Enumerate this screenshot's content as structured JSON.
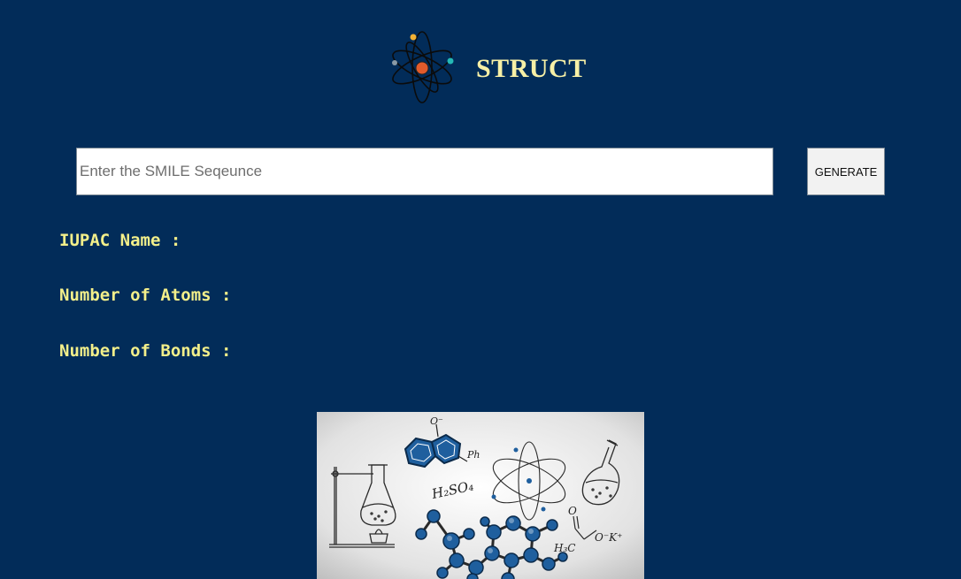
{
  "header": {
    "title": "STRUCT",
    "logo_icon": "atom-icon"
  },
  "search": {
    "placeholder": "Enter the SMILE Seqeunce",
    "value": ""
  },
  "generate_button": {
    "label": "GENERATE"
  },
  "results": {
    "iupac_label": "IUPAC Name :",
    "atoms_label": "Number of Atoms :",
    "bonds_label": "Number of Bonds :"
  },
  "illustration": {
    "icon": "chemistry-illustration",
    "formula_1": "H₂SO₄",
    "formula_2": "H₃C",
    "formula_3": "O⁻K⁺",
    "label_ph": "Ph",
    "label_o_minus": "O⁻",
    "label_o": "O"
  },
  "colors": {
    "background": "#022c59",
    "title": "#f7f0a6",
    "info_text": "#f3ef8a",
    "molecule_blue": "#1f5f9e"
  }
}
